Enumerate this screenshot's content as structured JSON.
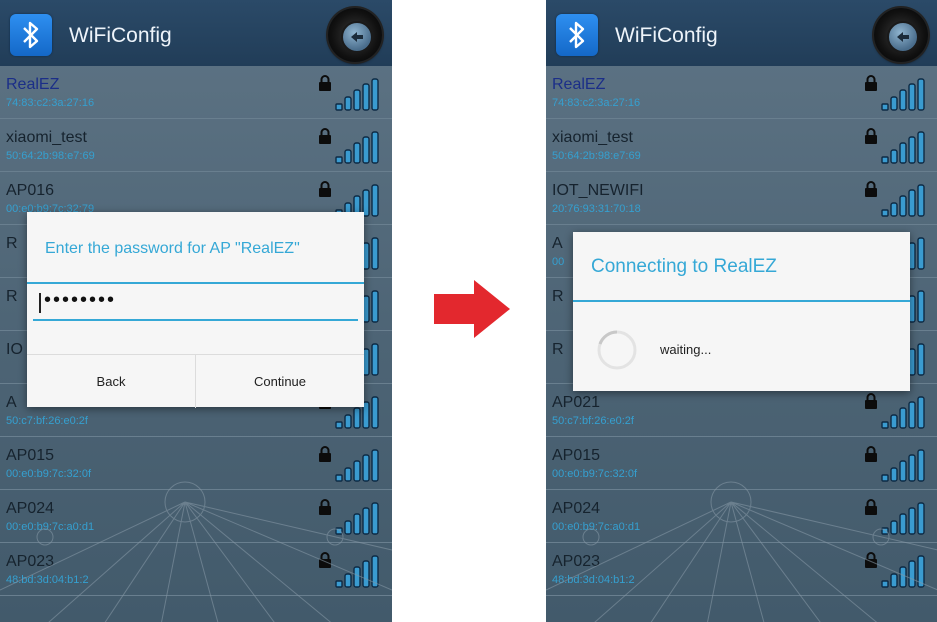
{
  "app": {
    "title": "WiFiConfig"
  },
  "icons": {
    "app": "bluetooth-icon",
    "back": "back-arrow-icon",
    "lock": "lock-icon",
    "signal": "wifi-signal-icon",
    "arrow": "right-arrow-icon"
  },
  "colors": {
    "accent": "#35a8d6",
    "transition_arrow": "#e3282e",
    "topbar": "#213d58"
  },
  "left_screen": {
    "networks": [
      {
        "ssid": "RealEZ",
        "mac": "74:83:c2:3a:27:16"
      },
      {
        "ssid": "xiaomi_test",
        "mac": "50:64:2b:98:e7:69"
      },
      {
        "ssid": "AP016",
        "mac": "00:e0:b9:7c:32:79"
      },
      {
        "ssid": "R",
        "mac": ""
      },
      {
        "ssid": "R",
        "mac": ""
      },
      {
        "ssid": "IO",
        "mac": ""
      },
      {
        "ssid": "A",
        "mac": "50:c7:bf:26:e0:2f"
      },
      {
        "ssid": "AP015",
        "mac": "00:e0:b9:7c:32:0f"
      },
      {
        "ssid": "AP024",
        "mac": "00:e0:b9:7c:a0:d1"
      },
      {
        "ssid": "AP023",
        "mac": "48:bd:3d:04:b1:2"
      }
    ],
    "password_dialog": {
      "title": "Enter the password for AP \"RealEZ\"",
      "password_value": "••••••••",
      "back_label": "Back",
      "continue_label": "Continue"
    }
  },
  "right_screen": {
    "networks": [
      {
        "ssid": "RealEZ",
        "mac": "74:83:c2:3a:27:16"
      },
      {
        "ssid": "xiaomi_test",
        "mac": "50:64:2b:98:e7:69"
      },
      {
        "ssid": "IOT_NEWIFI",
        "mac": "20:76:93:31:70:18"
      },
      {
        "ssid": "A",
        "mac": "00"
      },
      {
        "ssid": "R",
        "mac": ""
      },
      {
        "ssid": "R",
        "mac": ""
      },
      {
        "ssid": "AP021",
        "mac": "50:c7:bf:26:e0:2f"
      },
      {
        "ssid": "AP015",
        "mac": "00:e0:b9:7c:32:0f"
      },
      {
        "ssid": "AP024",
        "mac": "00:e0:b9:7c:a0:d1"
      },
      {
        "ssid": "AP023",
        "mac": "48:bd:3d:04:b1:2"
      }
    ],
    "connecting_dialog": {
      "title": "Connecting to RealEZ",
      "status": "waiting..."
    }
  }
}
